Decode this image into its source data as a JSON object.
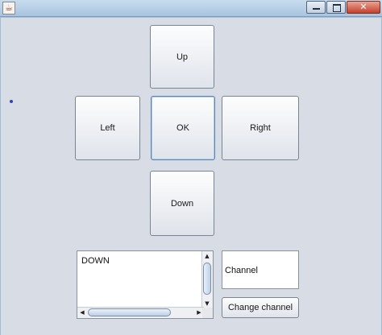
{
  "window": {
    "app_icon": "java-cup-icon",
    "controls": {
      "minimize": "minimize-icon",
      "maximize": "maximize-icon",
      "close": "close-icon",
      "close_glyph": "✕"
    }
  },
  "remote": {
    "up_label": "Up",
    "left_label": "Left",
    "ok_label": "OK",
    "right_label": "Right",
    "down_label": "Down"
  },
  "log": {
    "text": "DOWN"
  },
  "channel": {
    "value": "Channel",
    "change_label": "Change channel"
  }
}
